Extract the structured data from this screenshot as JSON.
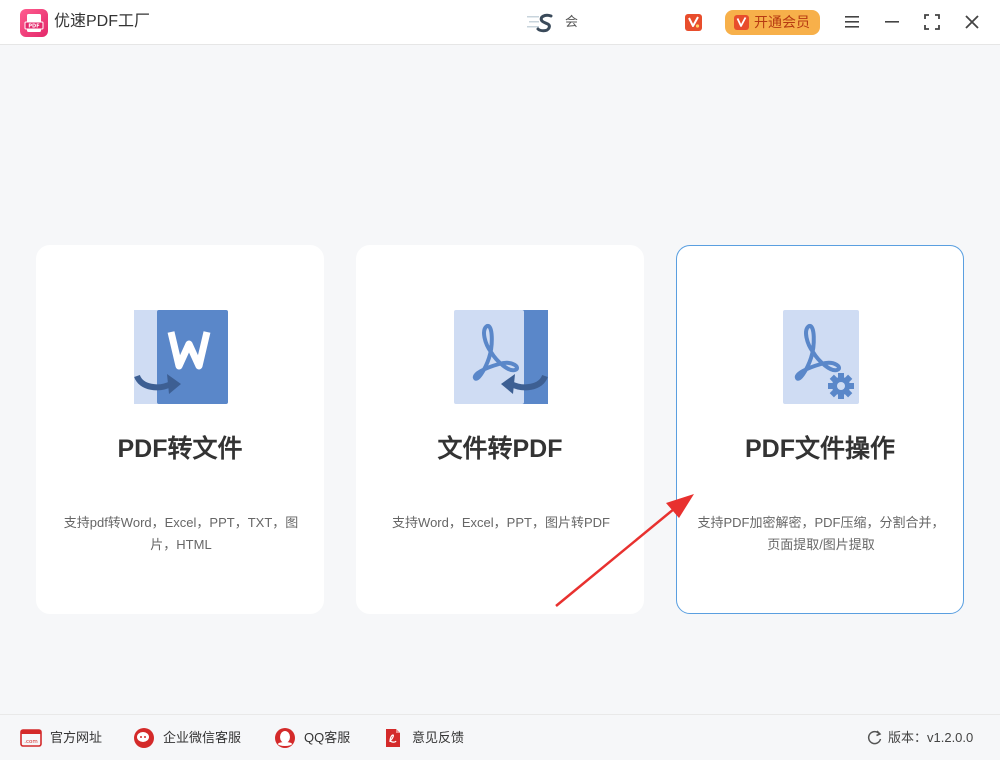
{
  "app": {
    "title": "优速PDF工厂",
    "logo_text": "PDF"
  },
  "user": {
    "name": "会"
  },
  "header": {
    "vip_button_label": "开通会员"
  },
  "cards": [
    {
      "title": "PDF转文件",
      "description": "支持pdf转Word，Excel，PPT，TXT，图片，HTML",
      "icon": "pdf-to-word-icon"
    },
    {
      "title": "文件转PDF",
      "description": "支持Word，Excel，PPT，图片转PDF",
      "icon": "file-to-pdf-icon"
    },
    {
      "title": "PDF文件操作",
      "description": "支持PDF加密解密，PDF压缩，分割合并，页面提取/图片提取",
      "icon": "pdf-settings-icon"
    }
  ],
  "footer": {
    "links": [
      {
        "label": "官方网址",
        "icon": "website-icon"
      },
      {
        "label": "企业微信客服",
        "icon": "wechat-work-icon"
      },
      {
        "label": "QQ客服",
        "icon": "qq-icon"
      },
      {
        "label": "意见反馈",
        "icon": "feedback-icon"
      }
    ],
    "version": "版本：v1.2.0.0"
  },
  "colors": {
    "accent_blue": "#5a87c9",
    "light_blue": "#cfdcf3",
    "vip_orange": "#f7b04a",
    "footer_red": "#d42a2a",
    "arrow_red": "#e8312f",
    "selected_border": "#5a9fe0"
  }
}
